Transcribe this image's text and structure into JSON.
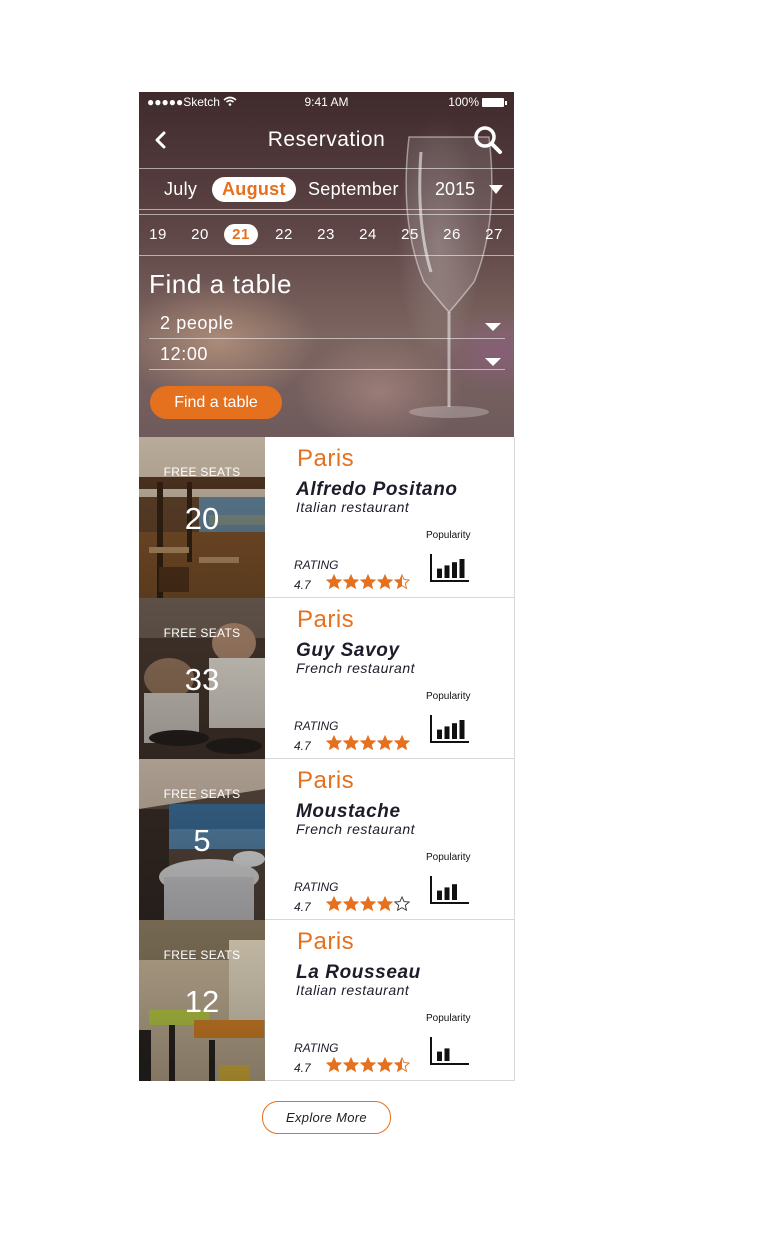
{
  "colors": {
    "accent": "#e5701e",
    "text_dark": "#1c1c2a"
  },
  "status_bar": {
    "carrier": "●●●●●Sketch",
    "time": "9:41 AM",
    "battery": "100%"
  },
  "header": {
    "title": "Reservation",
    "back_icon": "chevron-left-icon",
    "search_icon": "search-icon"
  },
  "months": {
    "items": [
      "July",
      "August",
      "September"
    ],
    "selected": "August",
    "year": "2015"
  },
  "days": {
    "items": [
      "19",
      "20",
      "21",
      "22",
      "23",
      "24",
      "25",
      "26",
      "27"
    ],
    "selected": "21"
  },
  "finder": {
    "heading": "Find a table",
    "people": "2 people",
    "time": "12:00",
    "button": "Find a table"
  },
  "restaurants": [
    {
      "city": "Paris",
      "name": "Alfredo Positano",
      "cuisine": "Italian restaurant",
      "free_label": "FREE SEATS",
      "free_seats": "20",
      "rating_label": "RATING",
      "rating": "4.7",
      "stars": 4.5,
      "popularity_label": "Popularity",
      "popularity_bars": [
        2,
        3,
        4,
        5
      ]
    },
    {
      "city": "Paris",
      "name": "Guy Savoy",
      "cuisine": "French restaurant",
      "free_label": "FREE SEATS",
      "free_seats": "33",
      "rating_label": "RATING",
      "rating": "4.7",
      "stars": 5,
      "popularity_label": "Popularity",
      "popularity_bars": [
        2,
        3,
        4,
        5
      ]
    },
    {
      "city": "Paris",
      "name": "Moustache",
      "cuisine": "French restaurant",
      "free_label": "FREE SEATS",
      "free_seats": "5",
      "rating_label": "RATING",
      "rating": "4.7",
      "stars": 4,
      "popularity_label": "Popularity",
      "popularity_bars": [
        2,
        3,
        4
      ]
    },
    {
      "city": "Paris",
      "name": "La Rousseau",
      "cuisine": "Italian restaurant",
      "free_label": "FREE SEATS",
      "free_seats": "12",
      "rating_label": "RATING",
      "rating": "4.7",
      "stars": 4.5,
      "popularity_label": "Popularity",
      "popularity_bars": [
        2,
        3
      ]
    }
  ],
  "explore_button": "Explore More"
}
